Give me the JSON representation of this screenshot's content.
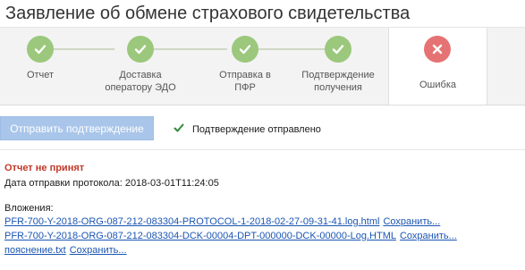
{
  "header": {
    "title": "Заявление об обмене страхового свидетельства"
  },
  "steps": [
    {
      "label": "Отчет",
      "status": "done",
      "icon": "check-icon"
    },
    {
      "label": "Доставка оператору ЭДО",
      "status": "done",
      "icon": "check-icon"
    },
    {
      "label": "Отправка в ПФР",
      "status": "done",
      "icon": "check-icon"
    },
    {
      "label": "Подтверждение получения",
      "status": "done",
      "icon": "check-icon"
    },
    {
      "label": "Ошибка",
      "status": "error",
      "icon": "close-icon"
    }
  ],
  "actions": {
    "send_confirmation_label": "Отправить подтверждение",
    "confirmation_status": "Подтверждение отправлено"
  },
  "result": {
    "error_title": "Отчет не принят",
    "sent_date": "Дата отправки протокола: 2018-03-01T11:24:05"
  },
  "attachments": {
    "heading": "Вложения:",
    "save_label": "Сохранить...",
    "items": [
      {
        "name": "PFR-700-Y-2018-ORG-087-212-083304-PROTOCOL-1-2018-02-27-09-31-41.log.html"
      },
      {
        "name": "PFR-700-Y-2018-ORG-087-212-083304-DCK-00004-DPT-000000-DCK-00000-Log.HTML"
      },
      {
        "name": "пояснение.txt"
      }
    ]
  },
  "colors": {
    "done": "#9bc87c",
    "error": "#e57373",
    "link": "#1a55b3",
    "error_text": "#c0392b",
    "button_disabled": "#a9c6ea"
  }
}
